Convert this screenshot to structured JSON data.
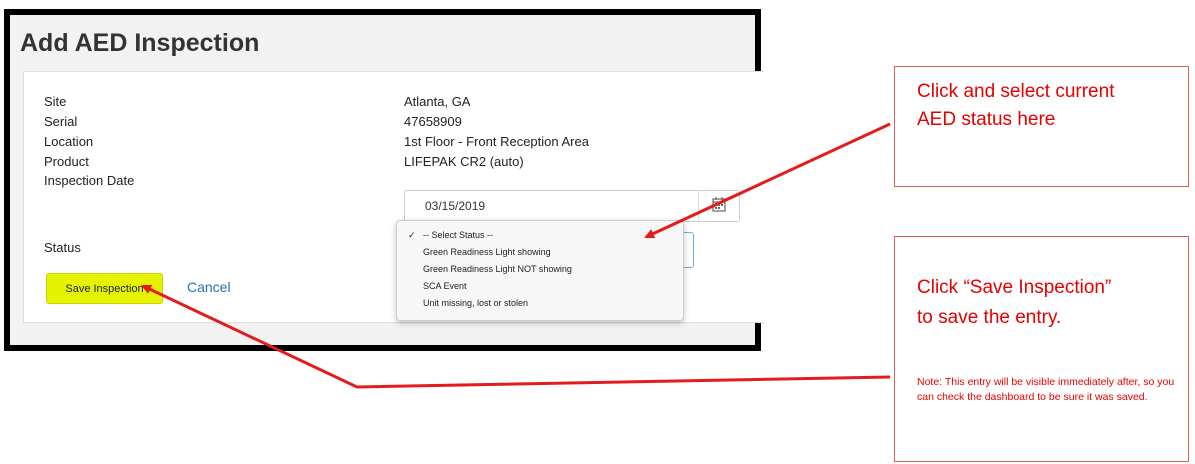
{
  "form": {
    "title": "Add AED Inspection",
    "fields": [
      {
        "label": "Site",
        "value": "Atlanta, GA"
      },
      {
        "label": "Serial",
        "value": "47658909"
      },
      {
        "label": "Location",
        "value": "1st Floor - Front Reception Area"
      },
      {
        "label": "Product",
        "value": "LIFEPAK CR2 (auto)"
      }
    ],
    "inspection_date_label": "Inspection Date",
    "inspection_date_value": "03/15/2019",
    "status_label": "Status",
    "status_options": [
      "-- Select Status --",
      "Green Readiness Light showing",
      "Green Readiness Light NOT showing",
      "SCA Event",
      "Unit missing, lost or stolen"
    ],
    "status_selected_mark": "✓",
    "save_label": "Save Inspection",
    "cancel_label": "Cancel"
  },
  "callouts": {
    "status": {
      "lines": [
        "Click and select current",
        "AED status here"
      ]
    },
    "save": {
      "lines": [
        "Click “Save Inspection”",
        "to save the entry."
      ],
      "note": "Note: This entry will be visible immediately after, so you can check the dashboard to be sure it was saved."
    }
  },
  "colors": {
    "callout_text": "#e60000",
    "arrow": "#e31b1b",
    "save_highlight": "#e5f200",
    "link": "#2a6ebd"
  },
  "icons": {
    "date_picker": "calendar-icon",
    "selected_option": "checkmark-icon"
  }
}
